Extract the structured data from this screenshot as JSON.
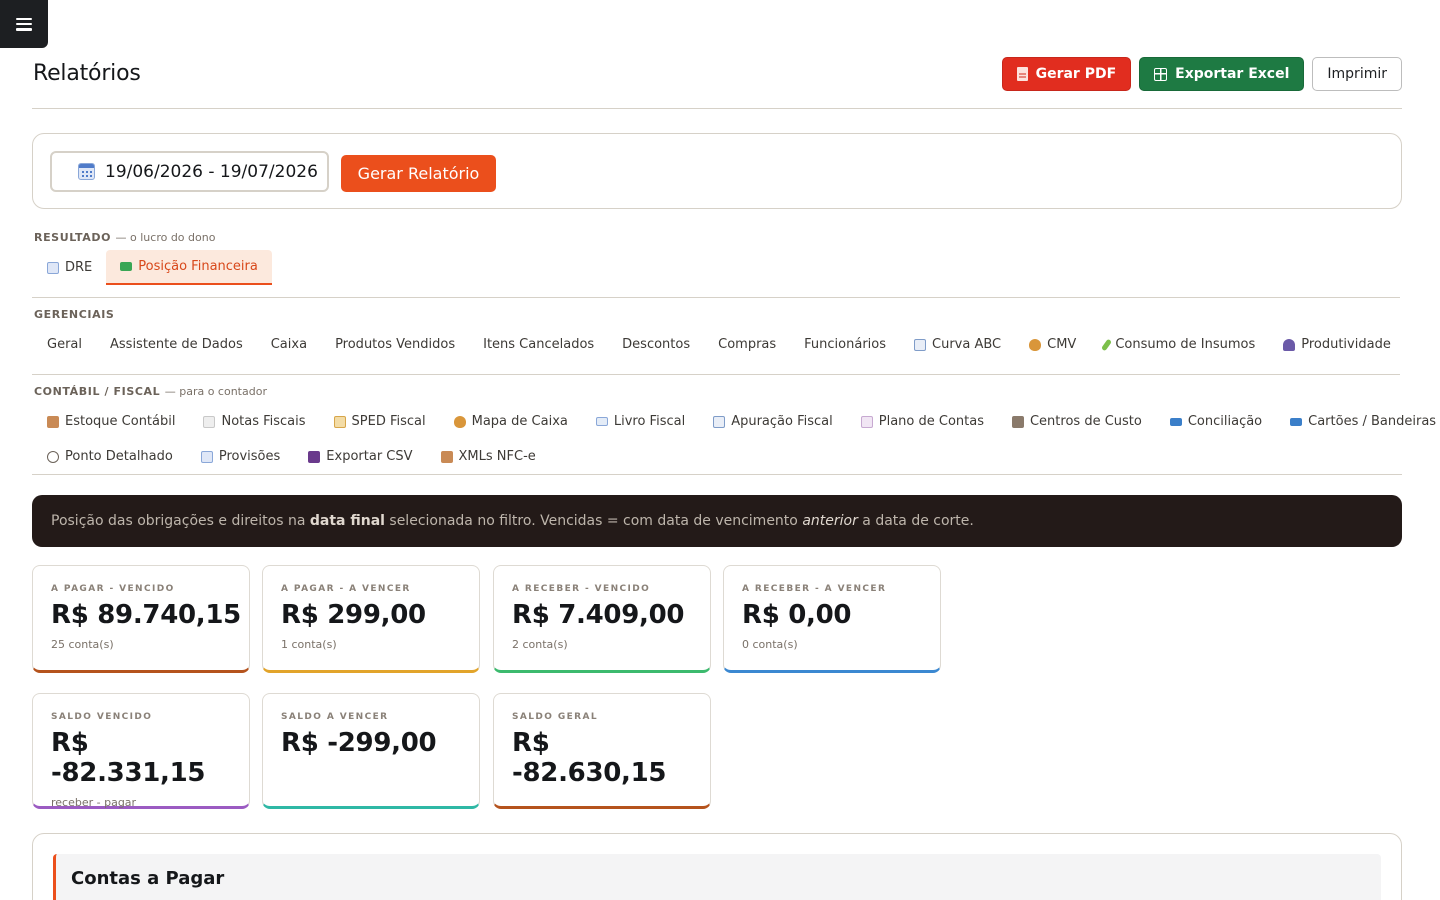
{
  "header": {
    "title": "Relatórios",
    "actions": {
      "pdf": "Gerar PDF",
      "excel": "Exportar Excel",
      "print": "Imprimir"
    }
  },
  "filter": {
    "date_range": "19/06/2026 - 19/07/2026",
    "generate": "Gerar Relatório"
  },
  "sections": {
    "resultado": {
      "title": "RESULTADO",
      "subtitle": "— o lucro do dono",
      "tabs": [
        {
          "label": "DRE",
          "icon": "chart-up-icon"
        },
        {
          "label": "Posição Financeira",
          "icon": "money-icon"
        }
      ]
    },
    "gerenciais": {
      "title": "GERENCIAIS",
      "tabs": [
        {
          "label": "Geral"
        },
        {
          "label": "Assistente de Dados"
        },
        {
          "label": "Caixa"
        },
        {
          "label": "Produtos Vendidos"
        },
        {
          "label": "Itens Cancelados"
        },
        {
          "label": "Descontos"
        },
        {
          "label": "Compras"
        },
        {
          "label": "Funcionários"
        },
        {
          "label": "Curva ABC",
          "icon": "bar-chart-icon"
        },
        {
          "label": "CMV",
          "icon": "money-bag-icon"
        },
        {
          "label": "Consumo de Insumos",
          "icon": "test-tube-icon"
        },
        {
          "label": "Produtividade",
          "icon": "people-icon"
        }
      ]
    },
    "contabil": {
      "title": "CONTÁBIL / FISCAL",
      "subtitle": "— para o contador",
      "tabs": [
        {
          "label": "Estoque Contábil",
          "icon": "package-icon"
        },
        {
          "label": "Notas Fiscais",
          "icon": "document-icon"
        },
        {
          "label": "SPED Fiscal",
          "icon": "scroll-icon"
        },
        {
          "label": "Mapa de Caixa",
          "icon": "money-bag-icon"
        },
        {
          "label": "Livro Fiscal",
          "icon": "book-icon"
        },
        {
          "label": "Apuração Fiscal",
          "icon": "bar-chart-icon"
        },
        {
          "label": "Plano de Contas",
          "icon": "notepad-icon"
        },
        {
          "label": "Centros de Custo",
          "icon": "office-icon"
        },
        {
          "label": "Conciliação",
          "icon": "card-icon"
        },
        {
          "label": "Cartões / Bandeiras",
          "icon": "card-icon"
        },
        {
          "label": "Ponto Detalhado",
          "icon": "clock-icon"
        },
        {
          "label": "Provisões",
          "icon": "calendar-icon"
        },
        {
          "label": "Exportar CSV",
          "icon": "floppy-icon"
        },
        {
          "label": "XMLs NFC-e",
          "icon": "package-icon"
        }
      ]
    }
  },
  "notice": {
    "part1": "Posição das obrigações e direitos na ",
    "bold": "data final",
    "part2": " selecionada no filtro. Vencidas = com data de vencimento ",
    "italic": "anterior",
    "part3": " a data de corte."
  },
  "kpis": [
    {
      "label": "A PAGAR - VENCIDO",
      "value": "R$ 89.740,15",
      "sub": "25 conta(s)",
      "color": "#b5531d"
    },
    {
      "label": "A PAGAR - A VENCER",
      "value": "R$ 299,00",
      "sub": "1 conta(s)",
      "color": "#e2a42a"
    },
    {
      "label": "A RECEBER - VENCIDO",
      "value": "R$ 7.409,00",
      "sub": "2 conta(s)",
      "color": "#3cba6e"
    },
    {
      "label": "A RECEBER - A VENCER",
      "value": "R$ 0,00",
      "sub": "0 conta(s)",
      "color": "#3b88d1"
    },
    {
      "label": "SALDO VENCIDO",
      "value": "R$ -82.331,15",
      "sub": "receber - pagar",
      "color": "#9b5bc2"
    },
    {
      "label": "SALDO A VENCER",
      "value": "R$ -299,00",
      "sub": "",
      "color": "#2fb8a5"
    },
    {
      "label": "SALDO GERAL",
      "value": "R$ -82.630,15",
      "sub": "",
      "color": "#b5531d"
    }
  ],
  "contas_pagar": {
    "title": "Contas a Pagar"
  }
}
